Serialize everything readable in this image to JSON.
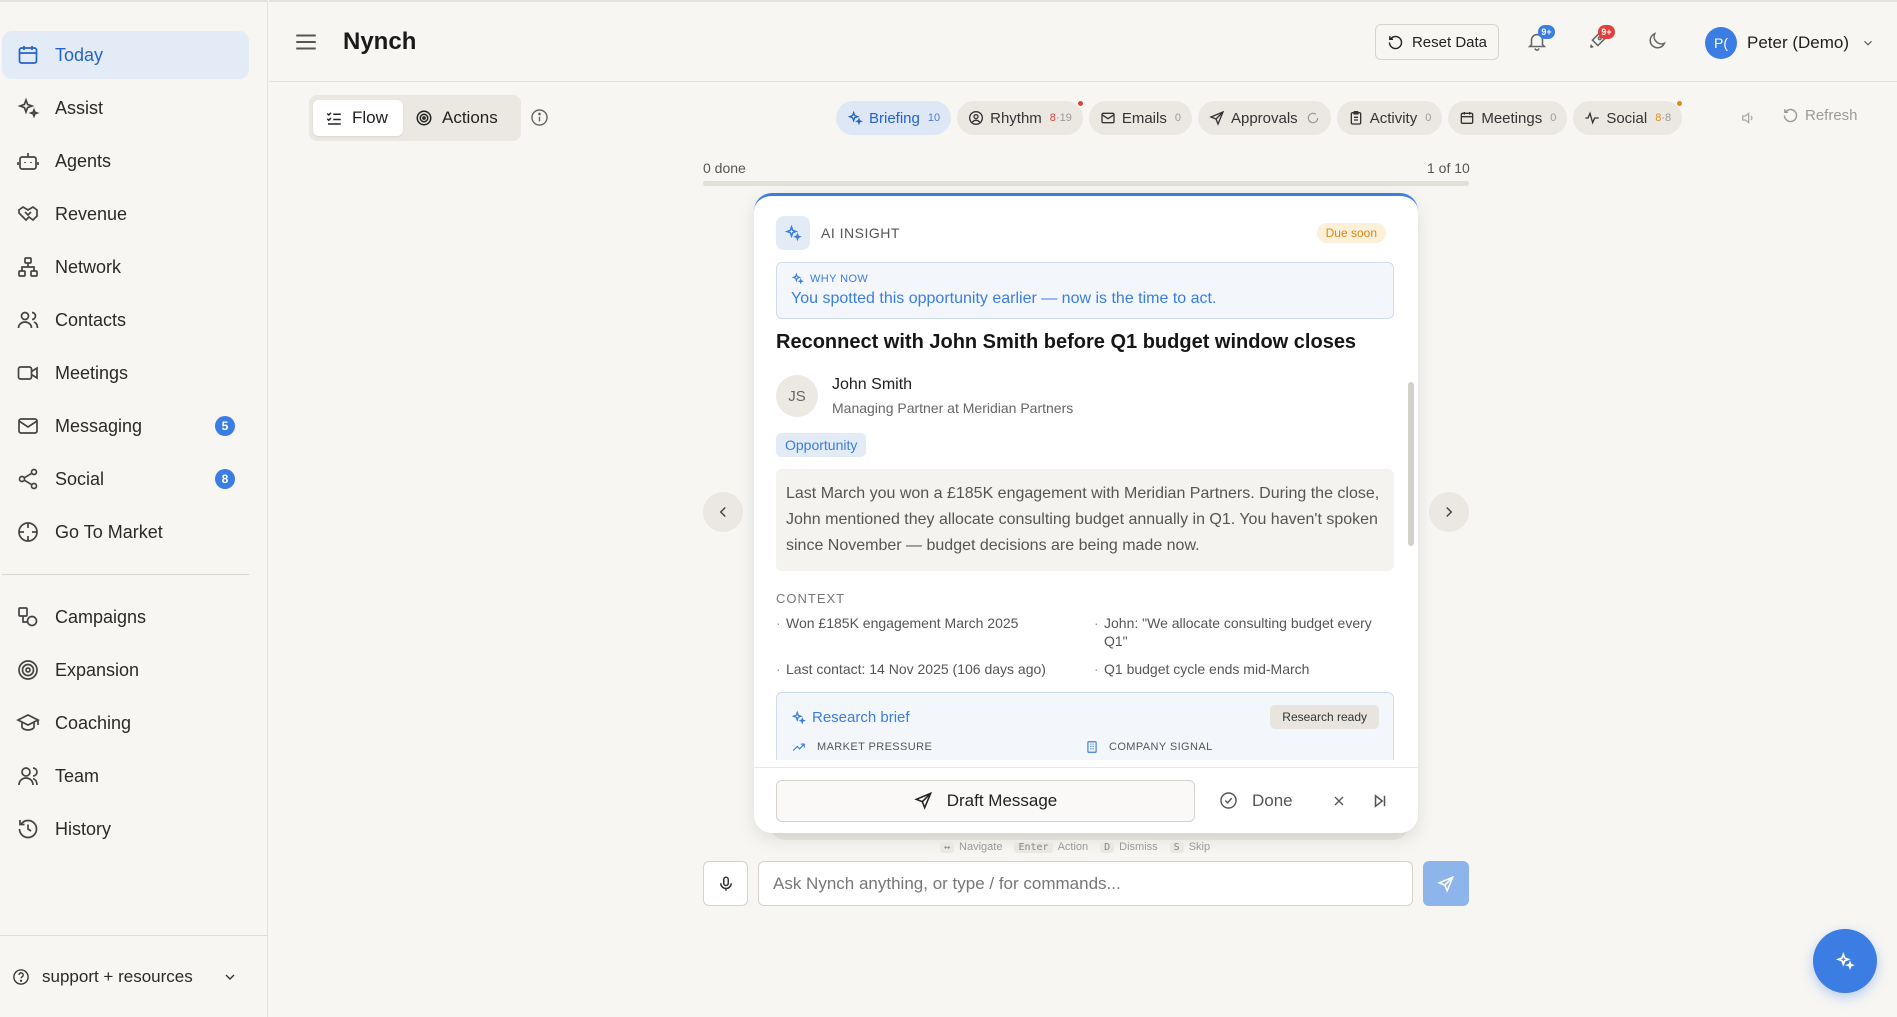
{
  "app": {
    "title": "Nynch"
  },
  "sidebar": {
    "items": [
      {
        "label": "Today",
        "icon": "calendar-icon"
      },
      {
        "label": "Assist",
        "icon": "sparkle-icon"
      },
      {
        "label": "Agents",
        "icon": "robot-icon"
      },
      {
        "label": "Revenue",
        "icon": "handshake-icon"
      },
      {
        "label": "Network",
        "icon": "network-icon"
      },
      {
        "label": "Contacts",
        "icon": "users-icon"
      },
      {
        "label": "Meetings",
        "icon": "video-icon"
      },
      {
        "label": "Messaging",
        "icon": "mail-icon",
        "badge": "5"
      },
      {
        "label": "Social",
        "icon": "share-icon",
        "badge": "8"
      },
      {
        "label": "Go To Market",
        "icon": "target-icon"
      },
      {
        "label": "Campaigns",
        "icon": "shapes-icon"
      },
      {
        "label": "Expansion",
        "icon": "bullseye-icon"
      },
      {
        "label": "Coaching",
        "icon": "graduation-cap-icon"
      },
      {
        "label": "Team",
        "icon": "team-icon"
      },
      {
        "label": "History",
        "icon": "history-icon"
      }
    ],
    "support_label": "support + resources"
  },
  "header": {
    "reset_label": "Reset Data",
    "notifications_badge": "9+",
    "rocket_badge": "9+",
    "user_initials": "P(",
    "user_name": "Peter (Demo)"
  },
  "toolbar": {
    "flow_label": "Flow",
    "actions_label": "Actions",
    "tabs": [
      {
        "label": "Briefing",
        "count": "10"
      },
      {
        "label": "Rhythm",
        "count_alert": "8",
        "count_total": "19"
      },
      {
        "label": "Emails",
        "count": "0"
      },
      {
        "label": "Approvals"
      },
      {
        "label": "Activity",
        "count": "0"
      },
      {
        "label": "Meetings",
        "count": "0"
      },
      {
        "label": "Social",
        "count_alert": "8",
        "count_total": "8"
      }
    ],
    "refresh_label": "Refresh"
  },
  "progress": {
    "done_label": "0 done",
    "position_label": "1 of 10",
    "fraction": 0.0
  },
  "card": {
    "kind_label": "AI INSIGHT",
    "due_label": "Due soon",
    "why_label": "WHY NOW",
    "why_text": "You spotted this opportunity earlier — now is the time to act.",
    "title": "Reconnect with John Smith before Q1 budget window closes",
    "person": {
      "initials": "JS",
      "name": "John Smith",
      "role": "Managing Partner at Meridian Partners"
    },
    "tag": "Opportunity",
    "description": "Last March you won a £185K engagement with Meridian Partners. During the close, John mentioned they allocate consulting budget annually in Q1. You haven't spoken since November — budget decisions are being made now.",
    "context_label": "CONTEXT",
    "context": [
      "Won £185K engagement March 2025",
      "John: \"We allocate consulting budget every Q1\"",
      "Last contact: 14 Nov 2025 (106 days ago)",
      "Q1 budget cycle ends mid-March"
    ],
    "research": {
      "title": "Research brief",
      "status": "Research ready",
      "col1": "MARKET PRESSURE",
      "col2": "COMPANY SIGNAL"
    },
    "draft_label": "Draft Message",
    "done_label": "Done"
  },
  "shortcuts": [
    {
      "key": "↔",
      "label": "Navigate"
    },
    {
      "key": "Enter",
      "label": "Action"
    },
    {
      "key": "D",
      "label": "Dismiss"
    },
    {
      "key": "S",
      "label": "Skip"
    }
  ],
  "chat": {
    "placeholder": "Ask Nynch anything, or type / for commands..."
  },
  "colors": {
    "accent": "#3b7de2",
    "alert": "#e0413b",
    "warning": "#e08a1e"
  }
}
